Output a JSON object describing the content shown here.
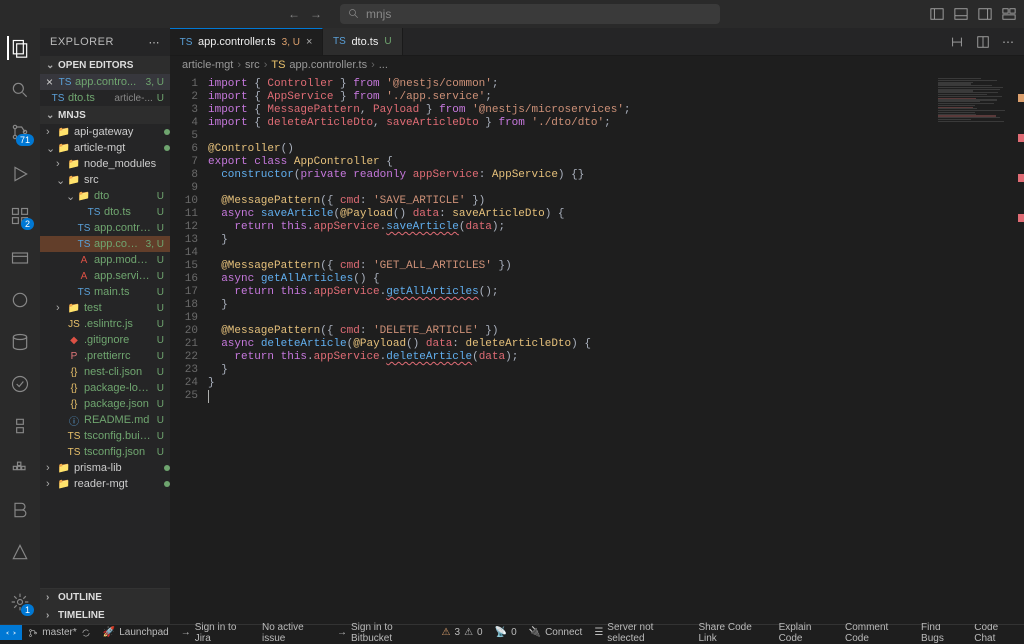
{
  "search_placeholder": "mnjs",
  "sidebar": {
    "title": "EXPLORER",
    "sections": {
      "open_editors": "OPEN EDITORS",
      "workspace": "MNJS",
      "outline": "OUTLINE",
      "timeline": "TIMELINE"
    },
    "open_editors": [
      {
        "name": "app.contro...",
        "suffix": "3, U",
        "status": "untr",
        "sel": true
      },
      {
        "name": "dto.ts",
        "sub": "article-...",
        "suffix": "U",
        "status": "untr"
      }
    ],
    "tree": [
      {
        "d": 0,
        "chev": "›",
        "ico": "fold",
        "name": "api-gateway",
        "dot": true
      },
      {
        "d": 0,
        "chev": "⌄",
        "ico": "fold",
        "name": "article-mgt",
        "dot": true,
        "mod": false
      },
      {
        "d": 1,
        "chev": "›",
        "ico": "fold",
        "name": "node_modules"
      },
      {
        "d": 1,
        "chev": "⌄",
        "ico": "fold",
        "name": "src",
        "mod": false
      },
      {
        "d": 2,
        "chev": "⌄",
        "ico": "fold",
        "name": "dto",
        "status": "untr",
        "sfx": "U"
      },
      {
        "d": 3,
        "ico": "ts",
        "name": "dto.ts",
        "status": "untr",
        "sfx": "U"
      },
      {
        "d": 2,
        "ico": "ts",
        "name": "app.controll...",
        "status": "untr",
        "sfx": "U"
      },
      {
        "d": 2,
        "ico": "ts",
        "name": "app.contr...",
        "status": "untr",
        "sfx": "3, U",
        "hl": true
      },
      {
        "d": 2,
        "ico": "angular",
        "name": "app.module...",
        "status": "untr",
        "sfx": "U"
      },
      {
        "d": 2,
        "ico": "angular",
        "name": "app.service.ts",
        "status": "untr",
        "sfx": "U"
      },
      {
        "d": 2,
        "ico": "ts",
        "name": "main.ts",
        "status": "untr",
        "sfx": "U"
      },
      {
        "d": 1,
        "chev": "›",
        "ico": "fold",
        "name": "test",
        "status": "untr",
        "sfx": "U"
      },
      {
        "d": 1,
        "ico": "js",
        "name": ".eslintrc.js",
        "status": "untr",
        "sfx": "U"
      },
      {
        "d": 1,
        "ico": "git",
        "name": ".gitignore",
        "status": "untr",
        "sfx": "U"
      },
      {
        "d": 1,
        "ico": "pret",
        "name": ".prettierrc",
        "status": "untr",
        "sfx": "U"
      },
      {
        "d": 1,
        "ico": "json",
        "name": "nest-cli.json",
        "status": "untr",
        "sfx": "U"
      },
      {
        "d": 1,
        "ico": "json",
        "name": "package-lock...",
        "status": "untr",
        "sfx": "U"
      },
      {
        "d": 1,
        "ico": "json",
        "name": "package.json",
        "status": "untr",
        "sfx": "U"
      },
      {
        "d": 1,
        "ico": "md",
        "name": "README.md",
        "status": "untr",
        "sfx": "U"
      },
      {
        "d": 1,
        "ico": "ts2",
        "name": "tsconfig.build...",
        "status": "untr",
        "sfx": "U"
      },
      {
        "d": 1,
        "ico": "ts2",
        "name": "tsconfig.json",
        "status": "untr",
        "sfx": "U"
      },
      {
        "d": 0,
        "chev": "›",
        "ico": "fold",
        "name": "prisma-lib",
        "dot": true
      },
      {
        "d": 0,
        "chev": "›",
        "ico": "fold",
        "name": "reader-mgt",
        "dot": true
      }
    ]
  },
  "tabs": [
    {
      "name": "app.controller.ts",
      "suffix": "3, U",
      "icon": "ts",
      "active": true,
      "close": "×"
    },
    {
      "name": "dto.ts",
      "suffix": "U",
      "icon": "ts",
      "u": true
    }
  ],
  "crumb": [
    "article-mgt",
    "src",
    "app.controller.ts",
    "..."
  ],
  "code_lines": [
    [
      [
        "kw",
        "import"
      ],
      [
        "pn",
        " { "
      ],
      [
        "var",
        "Controller"
      ],
      [
        "pn",
        " } "
      ],
      [
        "kw",
        "from"
      ],
      [
        "pn",
        " "
      ],
      [
        "str",
        "'@nestjs/common'"
      ],
      [
        "pn",
        ";"
      ]
    ],
    [
      [
        "kw",
        "import"
      ],
      [
        "pn",
        " { "
      ],
      [
        "var",
        "AppService"
      ],
      [
        "pn",
        " } "
      ],
      [
        "kw",
        "from"
      ],
      [
        "pn",
        " "
      ],
      [
        "str",
        "'./app.service'"
      ],
      [
        "pn",
        ";"
      ]
    ],
    [
      [
        "kw",
        "import"
      ],
      [
        "pn",
        " { "
      ],
      [
        "var",
        "MessagePattern"
      ],
      [
        "pn",
        ", "
      ],
      [
        "var",
        "Payload"
      ],
      [
        "pn",
        " } "
      ],
      [
        "kw",
        "from"
      ],
      [
        "pn",
        " "
      ],
      [
        "str",
        "'@nestjs/microservices'"
      ],
      [
        "pn",
        ";"
      ]
    ],
    [
      [
        "kw",
        "import"
      ],
      [
        "pn",
        " { "
      ],
      [
        "var",
        "deleteArticleDto"
      ],
      [
        "pn",
        ", "
      ],
      [
        "var",
        "saveArticleDto"
      ],
      [
        "pn",
        " } "
      ],
      [
        "kw",
        "from"
      ],
      [
        "pn",
        " "
      ],
      [
        "str",
        "'./dto/dto'"
      ],
      [
        "pn",
        ";"
      ]
    ],
    [],
    [
      [
        "dec",
        "@Controller"
      ],
      [
        "pn",
        "()"
      ]
    ],
    [
      [
        "kw",
        "export"
      ],
      [
        "pn",
        " "
      ],
      [
        "kw",
        "class"
      ],
      [
        "pn",
        " "
      ],
      [
        "cl",
        "AppController"
      ],
      [
        "pn",
        " {"
      ]
    ],
    [
      [
        "pn",
        "  "
      ],
      [
        "fn",
        "constructor"
      ],
      [
        "pn",
        "("
      ],
      [
        "kw",
        "private"
      ],
      [
        "pn",
        " "
      ],
      [
        "kw",
        "readonly"
      ],
      [
        "pn",
        " "
      ],
      [
        "var",
        "appService"
      ],
      [
        "pn",
        ": "
      ],
      [
        "cl",
        "AppService"
      ],
      [
        "pn",
        ") {}"
      ]
    ],
    [],
    [
      [
        "pn",
        "  "
      ],
      [
        "dec",
        "@MessagePattern"
      ],
      [
        "pn",
        "({ "
      ],
      [
        "var",
        "cmd"
      ],
      [
        "pn",
        ": "
      ],
      [
        "str",
        "'SAVE_ARTICLE'"
      ],
      [
        "pn",
        " })"
      ]
    ],
    [
      [
        "pn",
        "  "
      ],
      [
        "kw",
        "async"
      ],
      [
        "pn",
        " "
      ],
      [
        "fn",
        "saveArticle"
      ],
      [
        "pn",
        "("
      ],
      [
        "dec",
        "@Payload"
      ],
      [
        "pn",
        "() "
      ],
      [
        "var",
        "data"
      ],
      [
        "pn",
        ": "
      ],
      [
        "cl",
        "saveArticleDto"
      ],
      [
        "pn",
        ") {"
      ]
    ],
    [
      [
        "pn",
        "    "
      ],
      [
        "kw",
        "return"
      ],
      [
        "pn",
        " "
      ],
      [
        "kw",
        "this"
      ],
      [
        "pn",
        "."
      ],
      [
        "var",
        "appService"
      ],
      [
        "pn",
        "."
      ],
      [
        "fn wave",
        "saveArticle"
      ],
      [
        "pn",
        "("
      ],
      [
        "var",
        "data"
      ],
      [
        "pn",
        ");"
      ]
    ],
    [
      [
        "pn",
        "  }"
      ]
    ],
    [],
    [
      [
        "pn",
        "  "
      ],
      [
        "dec",
        "@MessagePattern"
      ],
      [
        "pn",
        "({ "
      ],
      [
        "var",
        "cmd"
      ],
      [
        "pn",
        ": "
      ],
      [
        "str",
        "'GET_ALL_ARTICLES'"
      ],
      [
        "pn",
        " })"
      ]
    ],
    [
      [
        "pn",
        "  "
      ],
      [
        "kw",
        "async"
      ],
      [
        "pn",
        " "
      ],
      [
        "fn",
        "getAllArticles"
      ],
      [
        "pn",
        "() {"
      ]
    ],
    [
      [
        "pn",
        "    "
      ],
      [
        "kw",
        "return"
      ],
      [
        "pn",
        " "
      ],
      [
        "kw",
        "this"
      ],
      [
        "pn",
        "."
      ],
      [
        "var",
        "appService"
      ],
      [
        "pn",
        "."
      ],
      [
        "fn wave",
        "getAllArticles"
      ],
      [
        "pn",
        "();"
      ]
    ],
    [
      [
        "pn",
        "  }"
      ]
    ],
    [],
    [
      [
        "pn",
        "  "
      ],
      [
        "dec",
        "@MessagePattern"
      ],
      [
        "pn",
        "({ "
      ],
      [
        "var",
        "cmd"
      ],
      [
        "pn",
        ": "
      ],
      [
        "str",
        "'DELETE_ARTICLE'"
      ],
      [
        "pn",
        " })"
      ]
    ],
    [
      [
        "pn",
        "  "
      ],
      [
        "kw",
        "async"
      ],
      [
        "pn",
        " "
      ],
      [
        "fn",
        "deleteArticle"
      ],
      [
        "pn",
        "("
      ],
      [
        "dec",
        "@Payload"
      ],
      [
        "pn",
        "() "
      ],
      [
        "var",
        "data"
      ],
      [
        "pn",
        ": "
      ],
      [
        "cl",
        "deleteArticleDto"
      ],
      [
        "pn",
        ") {"
      ]
    ],
    [
      [
        "pn",
        "    "
      ],
      [
        "kw",
        "return"
      ],
      [
        "pn",
        " "
      ],
      [
        "kw",
        "this"
      ],
      [
        "pn",
        "."
      ],
      [
        "var",
        "appService"
      ],
      [
        "pn",
        "."
      ],
      [
        "fn wave",
        "deleteArticle"
      ],
      [
        "pn",
        "("
      ],
      [
        "var",
        "data"
      ],
      [
        "pn",
        ");"
      ]
    ],
    [
      [
        "pn",
        "  }"
      ]
    ],
    [
      [
        "pn",
        "}"
      ]
    ],
    [
      [
        "cursor",
        ""
      ]
    ]
  ],
  "status": {
    "branch": "master*",
    "launchpad": "Launchpad",
    "jira": "Sign in to Jira",
    "issue": "No active issue",
    "bitbucket": "Sign in to Bitbucket",
    "problems": "3",
    "warnings": "0",
    "port": "0",
    "connect": "Connect",
    "server": "Server not selected",
    "right": [
      "Share Code Link",
      "Explain Code",
      "Comment Code",
      "Find Bugs",
      "Code Chat"
    ]
  },
  "activity_badges": {
    "scm": "71",
    "ext": "2",
    "gear": "1"
  }
}
